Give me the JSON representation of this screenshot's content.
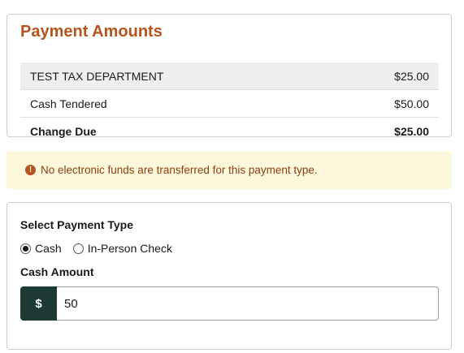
{
  "amounts": {
    "title": "Payment Amounts",
    "rows": [
      {
        "label": "TEST TAX DEPARTMENT",
        "value": "$25.00"
      },
      {
        "label": "Cash Tendered",
        "value": "$50.00"
      },
      {
        "label": "Change Due",
        "value": "$25.00"
      }
    ]
  },
  "alert": {
    "icon": "exclamation-circle-icon",
    "icon_glyph": "!",
    "message": "No electronic funds are transferred for this payment type."
  },
  "payment": {
    "type_label": "Select Payment Type",
    "options": [
      {
        "label": "Cash",
        "selected": true
      },
      {
        "label": "In-Person Check",
        "selected": false
      }
    ],
    "amount_label": "Cash Amount",
    "currency_symbol": "$",
    "amount_value": "50"
  },
  "colors": {
    "accent": "#b5541c",
    "alert_bg": "#fdf7dc",
    "prefix_bg": "#1d3a35"
  }
}
